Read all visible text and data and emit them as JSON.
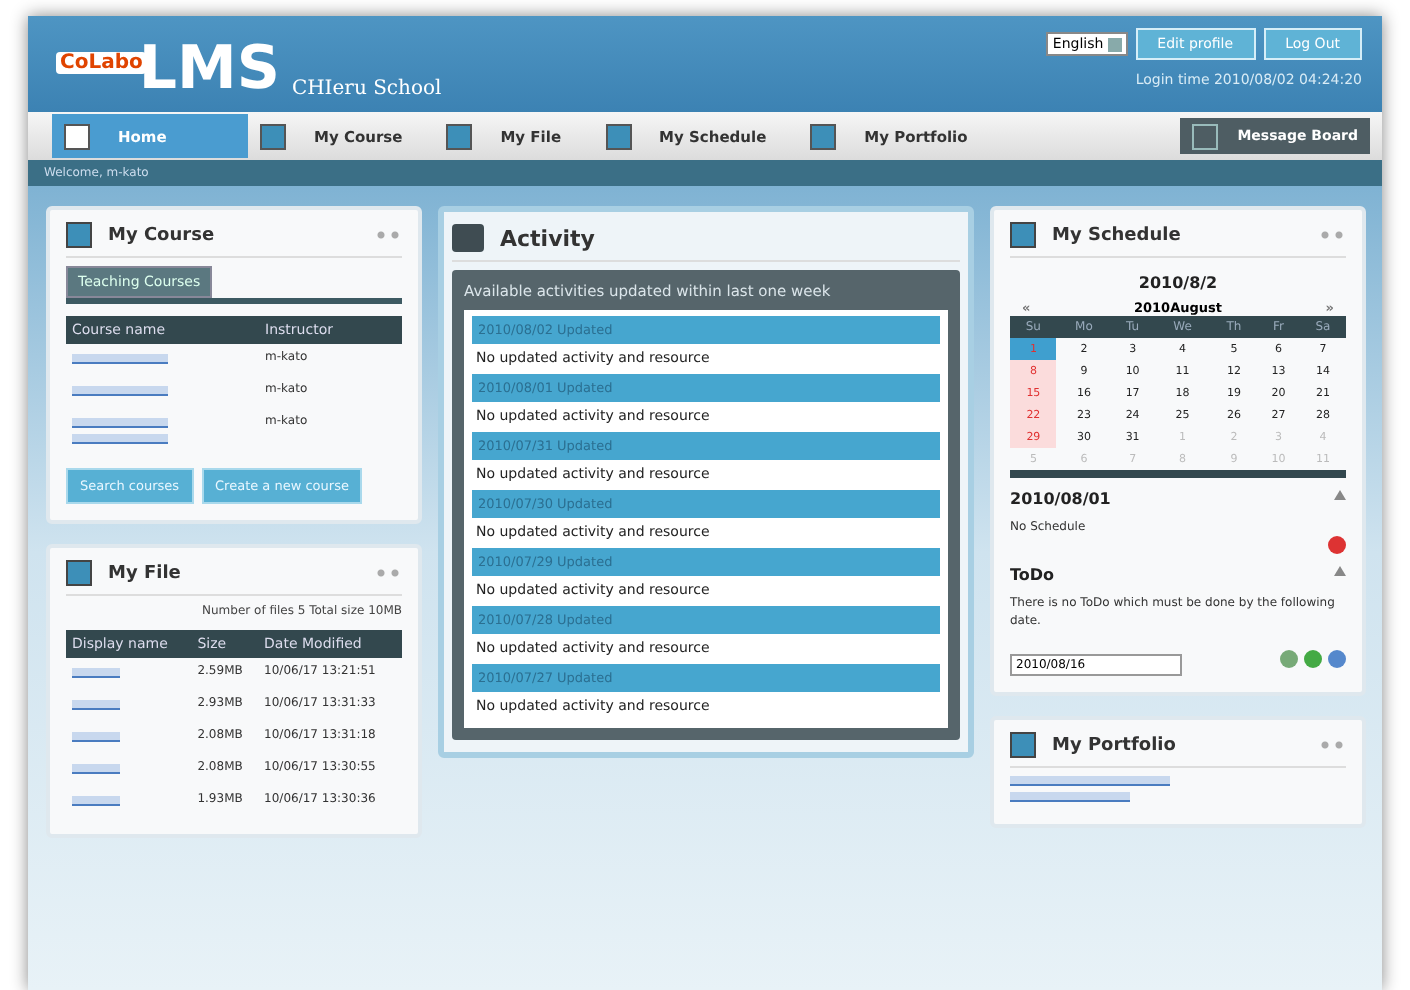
{
  "header": {
    "logo_prefix": "CoLabo",
    "logo": "LMS",
    "school": "CHIeru School",
    "language": "English",
    "buttons": [
      "Edit profile",
      "Log Out"
    ],
    "login_time": "Login time 2010/08/02 04:24:20"
  },
  "nav": {
    "items": [
      {
        "label": "Home",
        "selected": true
      },
      {
        "label": "My Course",
        "selected": false
      },
      {
        "label": "My File",
        "selected": false
      },
      {
        "label": "My Schedule",
        "selected": false
      },
      {
        "label": "My Portfolio",
        "selected": false
      }
    ],
    "board": "Message Board"
  },
  "welcome": "Welcome, m-kato",
  "my_course": {
    "title": "My Course",
    "tab": "Teaching Courses",
    "columns": [
      "Course name",
      "Instructor"
    ],
    "rows": [
      {
        "instructor": "m-kato",
        "kind": "short"
      },
      {
        "instructor": "m-kato",
        "kind": "short"
      },
      {
        "instructor": "m-kato",
        "kind": "long"
      }
    ],
    "buttons": [
      "Search courses",
      "Create a new course"
    ]
  },
  "my_file": {
    "title": "My File",
    "summary": "Number of files 5 Total size 10MB",
    "columns": [
      "Display name",
      "Size",
      "Date Modified"
    ],
    "files": [
      {
        "size": "2.59MB",
        "date_modified": "10/06/17 13:21:51"
      },
      {
        "size": "2.93MB",
        "date_modified": "10/06/17 13:31:33"
      },
      {
        "size": "2.08MB",
        "date_modified": "10/06/17 13:31:18"
      },
      {
        "size": "2.08MB",
        "date_modified": "10/06/17 13:30:55"
      },
      {
        "size": "1.93MB",
        "date_modified": "10/06/17 13:30:36"
      }
    ]
  },
  "activity": {
    "title": "Activity",
    "subtitle": "Available activities updated within last one week",
    "entries": [
      {
        "date": "2010/08/02 Updated",
        "text": "No updated activity and resource"
      },
      {
        "date": "2010/08/01 Updated",
        "text": "No updated activity and resource"
      },
      {
        "date": "2010/07/31 Updated",
        "text": "No updated activity and resource"
      },
      {
        "date": "2010/07/30 Updated",
        "text": "No updated activity and resource"
      },
      {
        "date": "2010/07/29 Updated",
        "text": "No updated activity and resource"
      },
      {
        "date": "2010/07/28 Updated",
        "text": "No updated activity and resource"
      },
      {
        "date": "2010/07/27 Updated",
        "text": "No updated activity and resource"
      }
    ]
  },
  "schedule": {
    "title": "My Schedule",
    "today": "2010/8/2",
    "month": "2010August",
    "prev": "«",
    "next": "»",
    "weekdays": [
      "Su",
      "Mo",
      "Tu",
      "We",
      "Th",
      "Fr",
      "Sa"
    ],
    "weeks": [
      [
        {
          "d": "1",
          "selected": true,
          "other": false
        },
        {
          "d": "2",
          "selected": false,
          "other": false
        },
        {
          "d": "3",
          "selected": false,
          "other": false
        },
        {
          "d": "4",
          "selected": false,
          "other": false
        },
        {
          "d": "5",
          "selected": false,
          "other": false
        },
        {
          "d": "6",
          "selected": false,
          "other": false
        },
        {
          "d": "7",
          "selected": false,
          "other": false
        }
      ],
      [
        {
          "d": "8",
          "selected": false,
          "other": false
        },
        {
          "d": "9",
          "selected": false,
          "other": false
        },
        {
          "d": "10",
          "selected": false,
          "other": false
        },
        {
          "d": "11",
          "selected": false,
          "other": false
        },
        {
          "d": "12",
          "selected": false,
          "other": false
        },
        {
          "d": "13",
          "selected": false,
          "other": false
        },
        {
          "d": "14",
          "selected": false,
          "other": false
        }
      ],
      [
        {
          "d": "15",
          "selected": false,
          "other": false
        },
        {
          "d": "16",
          "selected": false,
          "other": false
        },
        {
          "d": "17",
          "selected": false,
          "other": false
        },
        {
          "d": "18",
          "selected": false,
          "other": false
        },
        {
          "d": "19",
          "selected": false,
          "other": false
        },
        {
          "d": "20",
          "selected": false,
          "other": false
        },
        {
          "d": "21",
          "selected": false,
          "other": false
        }
      ],
      [
        {
          "d": "22",
          "selected": false,
          "other": false
        },
        {
          "d": "23",
          "selected": false,
          "other": false
        },
        {
          "d": "24",
          "selected": false,
          "other": false
        },
        {
          "d": "25",
          "selected": false,
          "other": false
        },
        {
          "d": "26",
          "selected": false,
          "other": false
        },
        {
          "d": "27",
          "selected": false,
          "other": false
        },
        {
          "d": "28",
          "selected": false,
          "other": false
        }
      ],
      [
        {
          "d": "29",
          "selected": false,
          "other": false
        },
        {
          "d": "30",
          "selected": false,
          "other": false
        },
        {
          "d": "31",
          "selected": false,
          "other": false
        },
        {
          "d": "1",
          "selected": false,
          "other": true
        },
        {
          "d": "2",
          "selected": false,
          "other": true
        },
        {
          "d": "3",
          "selected": false,
          "other": true
        },
        {
          "d": "4",
          "selected": false,
          "other": true
        }
      ],
      [
        {
          "d": "5",
          "selected": false,
          "other": true
        },
        {
          "d": "6",
          "selected": false,
          "other": true
        },
        {
          "d": "7",
          "selected": false,
          "other": true
        },
        {
          "d": "8",
          "selected": false,
          "other": true
        },
        {
          "d": "9",
          "selected": false,
          "other": true
        },
        {
          "d": "10",
          "selected": false,
          "other": true
        },
        {
          "d": "11",
          "selected": false,
          "other": true
        }
      ]
    ],
    "day_title": "2010/08/01",
    "day_text": "No Schedule",
    "todo_title": "ToDo",
    "todo_text": "There is no ToDo which must be done by the following date.",
    "todo_date": "2010/08/16"
  },
  "portfolio": {
    "title": "My Portfolio"
  }
}
